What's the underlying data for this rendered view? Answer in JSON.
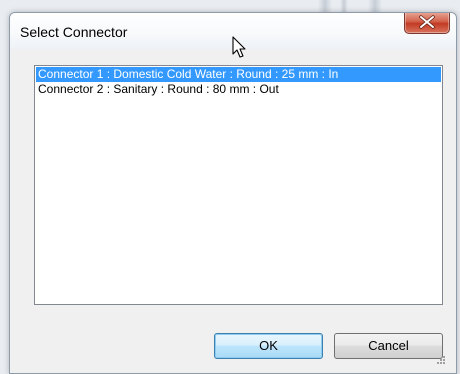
{
  "dialog": {
    "title": "Select Connector",
    "close_icon": "close-x-icon"
  },
  "connectors": {
    "items": [
      {
        "label": "Connector 1 : Domestic Cold Water : Round : 25 mm : In",
        "selected": true
      },
      {
        "label": "Connector 2 : Sanitary : Round : 80 mm : Out",
        "selected": false
      }
    ]
  },
  "buttons": {
    "ok_label": "OK",
    "cancel_label": "Cancel"
  },
  "colors": {
    "selection": "#3399ff",
    "close_button": "#c23b24",
    "default_button_border": "#3c7fb1"
  }
}
